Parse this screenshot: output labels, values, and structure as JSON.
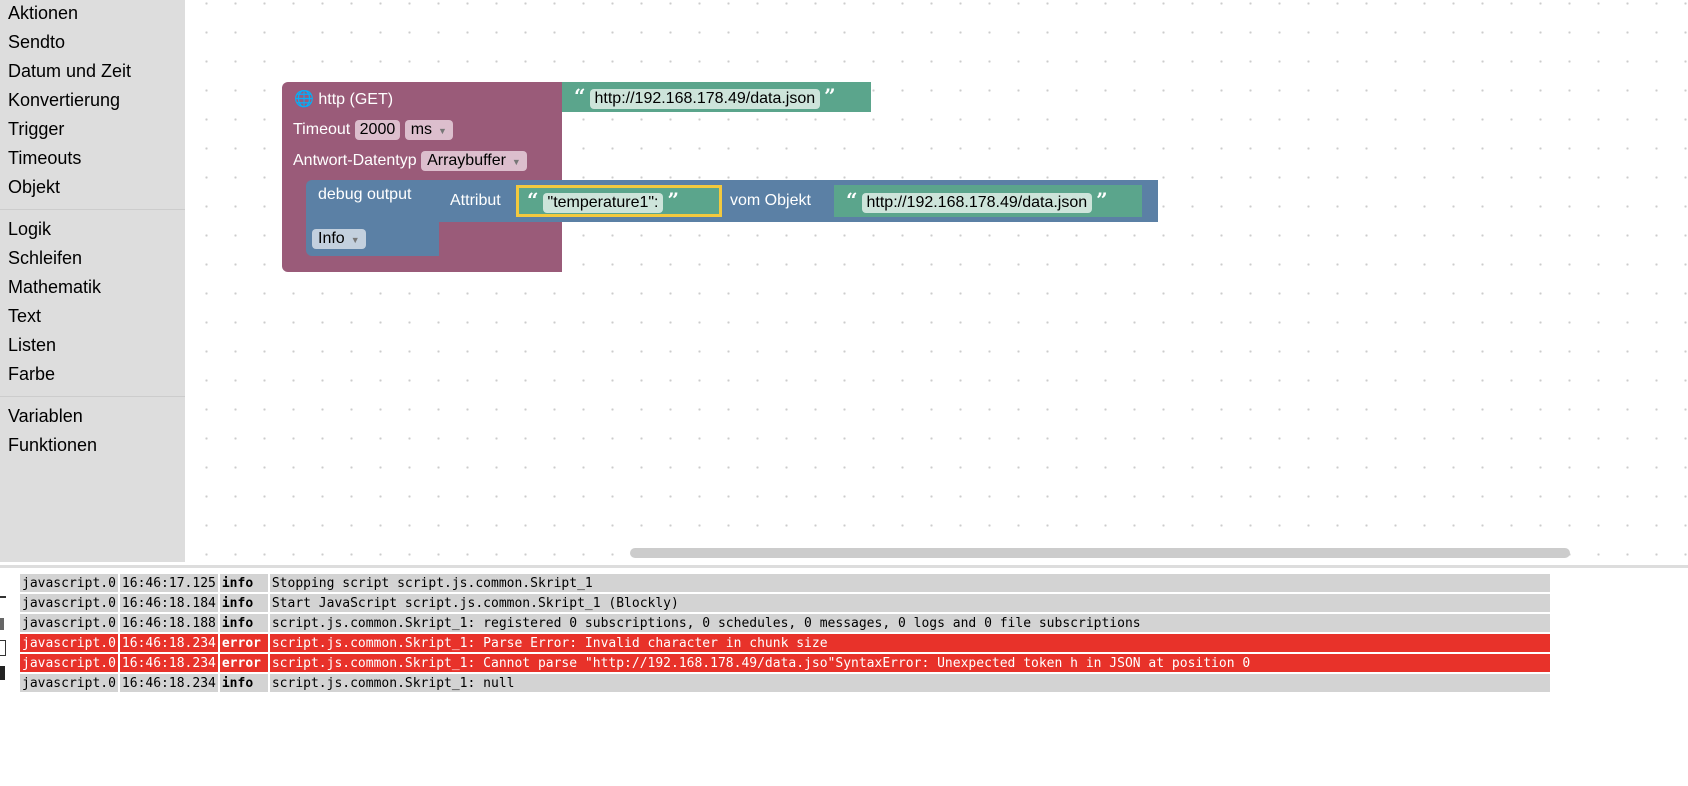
{
  "sidebar": {
    "groups": [
      [
        "Aktionen",
        "Sendto",
        "Datum und Zeit",
        "Konvertierung",
        "Trigger",
        "Timeouts",
        "Objekt"
      ],
      [
        "Logik",
        "Schleifen",
        "Mathematik",
        "Text",
        "Listen",
        "Farbe"
      ],
      [
        "Variablen",
        "Funktionen"
      ]
    ]
  },
  "blocks": {
    "http": {
      "title": "http (GET)",
      "timeout_label": "Timeout",
      "timeout_value": "2000",
      "unit": "ms",
      "type_label": "Antwort-Datentyp",
      "type_value": "Arraybuffer",
      "url": "http://192.168.178.49/data.json",
      "color": "#9a5b79"
    },
    "debug": {
      "title": "debug output",
      "level": "Info",
      "attr_label": "Attribut",
      "attr_value": "\"temperature1\":",
      "obj_label": "vom Objekt",
      "obj_value": "http://192.168.178.49/data.json",
      "color": "#5b80a5"
    },
    "text_color": "#5ba58c"
  },
  "log": {
    "rows": [
      {
        "source": "javascript.0",
        "time": "16:46:17.125",
        "severity": "info",
        "message": "Stopping script script.js.common.Skript_1"
      },
      {
        "source": "javascript.0",
        "time": "16:46:18.184",
        "severity": "info",
        "message": "Start JavaScript script.js.common.Skript_1 (Blockly)"
      },
      {
        "source": "javascript.0",
        "time": "16:46:18.188",
        "severity": "info",
        "message": "script.js.common.Skript_1: registered 0 subscriptions, 0 schedules, 0 messages, 0 logs and 0 file subscriptions"
      },
      {
        "source": "javascript.0",
        "time": "16:46:18.234",
        "severity": "error",
        "message": "script.js.common.Skript_1: Parse Error: Invalid character in chunk size"
      },
      {
        "source": "javascript.0",
        "time": "16:46:18.234",
        "severity": "error",
        "message": "script.js.common.Skript_1: Cannot parse \"http://192.168.178.49/data.jso\"SyntaxError: Unexpected token h in JSON at position 0"
      },
      {
        "source": "javascript.0",
        "time": "16:46:18.234",
        "severity": "info",
        "message": "script.js.common.Skript_1: null"
      }
    ]
  }
}
